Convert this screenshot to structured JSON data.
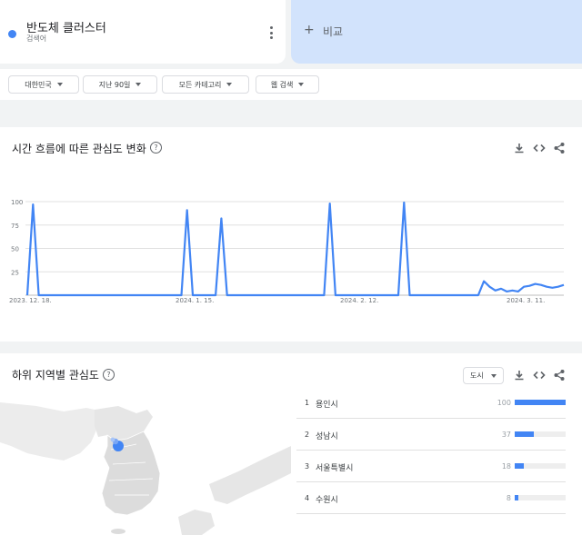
{
  "search_term": {
    "name": "반도체 클러스터",
    "type": "검색어",
    "color": "#4285f4"
  },
  "compare": {
    "plus": "+",
    "label": "비교"
  },
  "filters": [
    {
      "label": "대한민국"
    },
    {
      "label": "지난 90일"
    },
    {
      "label": "모든 카테고리"
    },
    {
      "label": "웹 검색"
    }
  ],
  "interest_over_time": {
    "title": "시간 흐름에 따른 관심도 변화",
    "help": "?"
  },
  "chart_data": {
    "type": "line",
    "x_tick_labels": [
      "2023. 12. 18.",
      "2024. 1. 15.",
      "2024. 2. 12.",
      "2024. 3. 11."
    ],
    "y_ticks": [
      100,
      75,
      50,
      25
    ],
    "ylim": [
      0,
      100
    ],
    "grid": true,
    "series": [
      {
        "color": "#4285f4",
        "values": [
          0,
          97,
          0,
          0,
          0,
          0,
          0,
          0,
          0,
          0,
          0,
          0,
          0,
          0,
          0,
          0,
          0,
          0,
          0,
          0,
          0,
          0,
          0,
          0,
          0,
          0,
          0,
          0,
          91,
          0,
          0,
          0,
          0,
          0,
          82,
          0,
          0,
          0,
          0,
          0,
          0,
          0,
          0,
          0,
          0,
          0,
          0,
          0,
          0,
          0,
          0,
          0,
          0,
          98,
          0,
          0,
          0,
          0,
          0,
          0,
          0,
          0,
          0,
          0,
          0,
          0,
          99,
          0,
          0,
          0,
          0,
          0,
          0,
          0,
          0,
          0,
          0,
          0,
          0,
          0,
          15,
          9,
          5,
          7,
          4,
          5,
          4,
          9,
          10,
          12,
          11,
          9,
          8,
          9,
          11
        ]
      }
    ]
  },
  "region": {
    "title": "하위 지역별 관심도",
    "help": "?",
    "select_label": "도시",
    "rows": [
      {
        "rank": "1",
        "name": "용인시",
        "value": "100",
        "fraction": 1.0
      },
      {
        "rank": "2",
        "name": "성남시",
        "value": "37",
        "fraction": 0.37
      },
      {
        "rank": "3",
        "name": "서울특별시",
        "value": "18",
        "fraction": 0.18
      },
      {
        "rank": "4",
        "name": "수원시",
        "value": "8",
        "fraction": 0.08
      }
    ]
  }
}
